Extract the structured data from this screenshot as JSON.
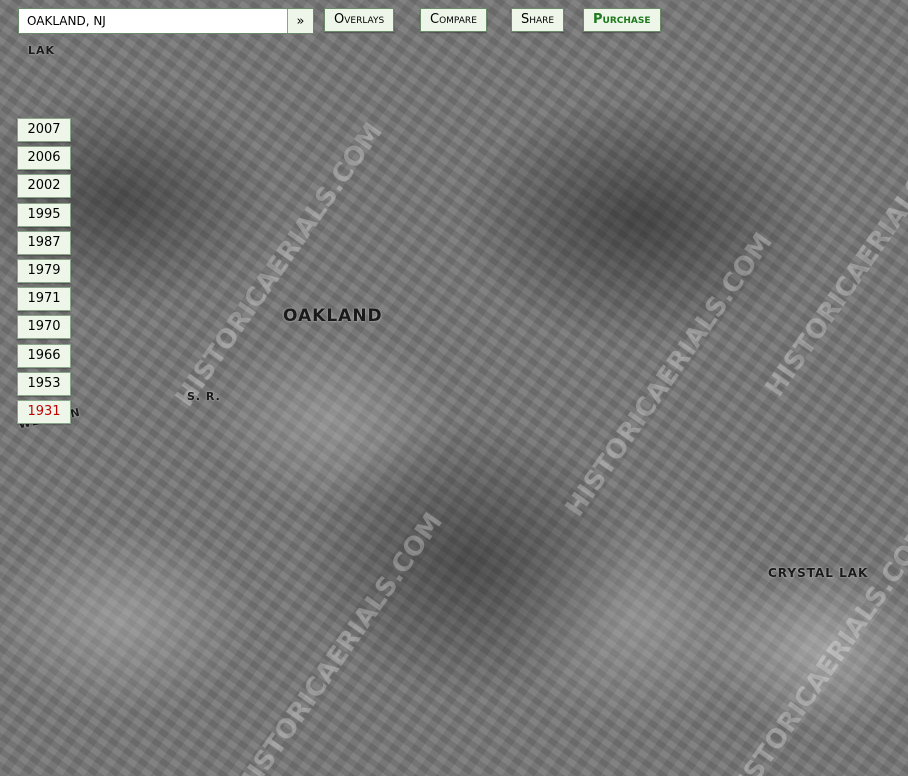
{
  "search": {
    "value": "oakland, nj",
    "go_label": "»"
  },
  "toolbar": {
    "overlays_label": "Overlays",
    "compare_label": "Compare",
    "share_label": "Share",
    "purchase_label": "Purchase",
    "purchase_color": "#1e7a1e"
  },
  "years": [
    "2007",
    "2006",
    "2002",
    "1995",
    "1987",
    "1979",
    "1971",
    "1970",
    "1966",
    "1953",
    "1931"
  ],
  "active_year": "1931",
  "active_year_color": "#c00000",
  "map": {
    "labels": [
      "OAKLAND",
      "CRYSTAL LAK",
      "WEST'RN",
      "S. R.",
      "LAK"
    ],
    "watermark": "HISTORICAERIALS.COM"
  }
}
